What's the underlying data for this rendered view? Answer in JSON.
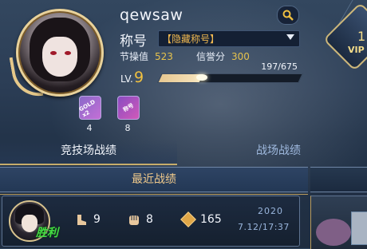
{
  "profile": {
    "name": "qewsaw",
    "title_label": "称号",
    "title_value": "【隐藏称号】",
    "stat_conduct_label": "节操值",
    "stat_conduct_value": "523",
    "stat_credit_label": "信誉分",
    "stat_credit_value": "300",
    "level_label": "LV.",
    "level_value": "9",
    "exp_text": "197/675",
    "exp_fraction": 0.29,
    "vip_label": "VIP",
    "vip_digit": "1"
  },
  "items": [
    {
      "name": "gold-x2-card",
      "badge": "GOLD x2",
      "count": "4"
    },
    {
      "name": "title-card",
      "badge": "称号",
      "count": "8"
    }
  ],
  "tabs": [
    {
      "label": "竞技场战绩",
      "active": true
    },
    {
      "label": "战场战绩",
      "active": false
    }
  ],
  "section": {
    "title": "最近战绩"
  },
  "records": [
    {
      "result": "胜利",
      "kills": "9",
      "mvp": "8",
      "score": "165",
      "year": "2020",
      "datetime": "7.12/17:37"
    }
  ],
  "colors": {
    "accent_gold": "#e5c24d",
    "win_green": "#44dd44",
    "title_orange": "#f0b850",
    "inactive_tab": "#9fb9de"
  },
  "icons": {
    "search": "search-icon",
    "kills": "boot-icon",
    "mvp": "fist-icon",
    "score": "diamond-icon",
    "dropdown": "chevron-down-icon"
  }
}
